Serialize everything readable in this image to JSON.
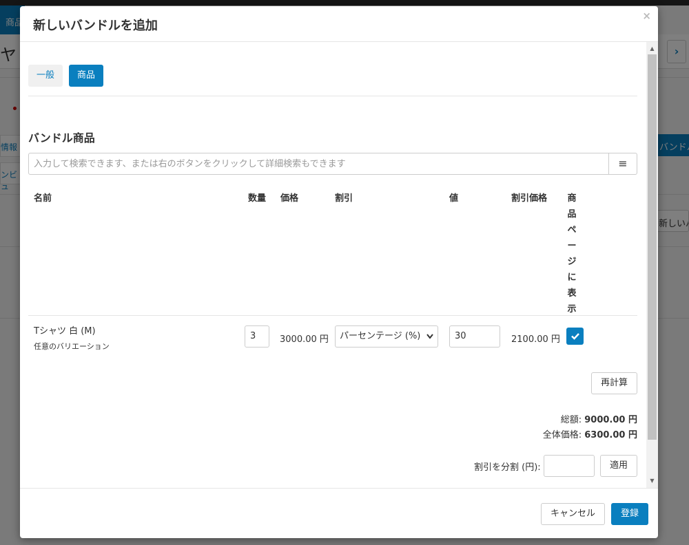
{
  "background": {
    "tab_label": "商品",
    "title": "ヤ",
    "side_item_1": "情報",
    "side_item_2": "ンビュ",
    "bundle_button": "バンドル",
    "new_button": "新しいバ",
    "next_icon": "›"
  },
  "modal": {
    "title": "新しいバンドルを追加",
    "close_icon": "×",
    "tabs": [
      {
        "label": "一般"
      },
      {
        "label": "商品"
      }
    ],
    "section_title": "バンドル商品",
    "search": {
      "placeholder": "入力して検索できます、または右のボタンをクリックして詳細検索もできます",
      "menu_icon": "≡"
    },
    "table": {
      "headers": {
        "name": "名前",
        "quantity": "数量",
        "price": "価格",
        "discount": "割引",
        "value": "値",
        "discount_price": "割引価格",
        "show_on_page": [
          "商",
          "品",
          "ペ",
          "ー",
          "ジ",
          "に",
          "表",
          "示"
        ]
      },
      "rows": [
        {
          "name": "Tシャツ 白 (M)",
          "variation": "任意のバリエーション",
          "quantity": "3",
          "price": "3000.00 円",
          "discount_type": "パーセンテージ (%)",
          "value": "30",
          "discount_price": "2100.00 円",
          "show_on_page": true
        }
      ]
    },
    "recalc_button": "再計算",
    "totals": {
      "total_label": "総額:",
      "total_value": "9000.00 円",
      "overall_label": "全体価格:",
      "overall_value": "6300.00 円"
    },
    "split": {
      "label": "割引を分割 (円):",
      "value": "",
      "apply_button": "適用"
    },
    "footer": {
      "cancel_button": "キャンセル",
      "save_button": "登録"
    }
  },
  "colors": {
    "primary": "#0a7fbf",
    "overlay": "rgba(0,0,0,0.5)"
  }
}
